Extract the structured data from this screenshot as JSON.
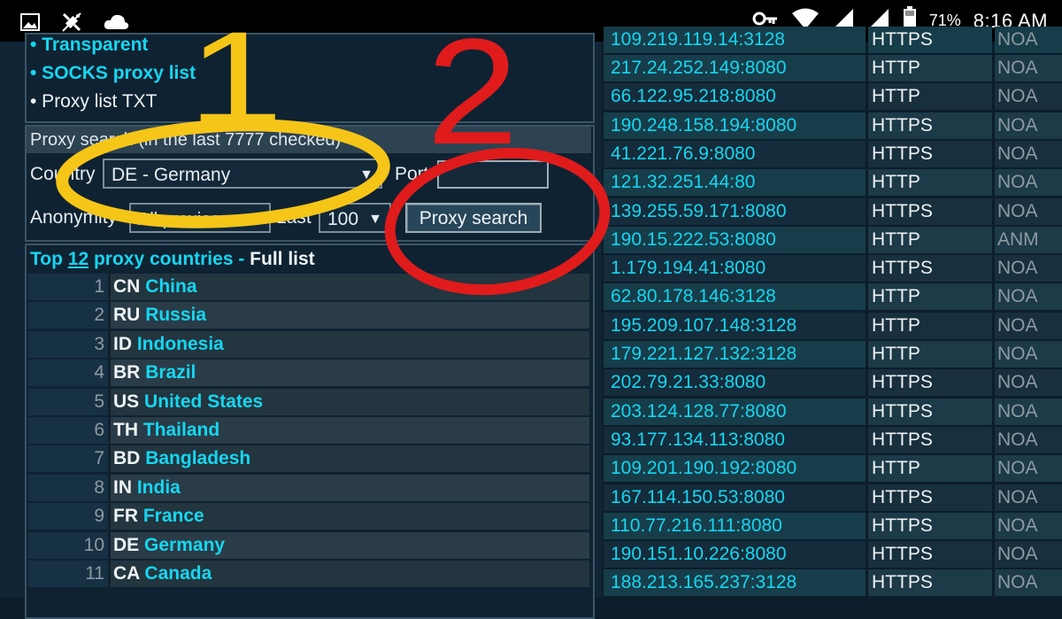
{
  "status_bar": {
    "battery_percent": "71%",
    "time": "8:16 AM",
    "icons": [
      "image-icon",
      "satellite-icon",
      "cloud-icon",
      "key-icon",
      "wifi-icon",
      "signal-icon",
      "signal-icon",
      "battery-icon"
    ]
  },
  "menu": {
    "transparent": "• Transparent",
    "socks": "• SOCKS proxy list",
    "txt": "• Proxy list TXT"
  },
  "search": {
    "title": "Proxy search (in the last 7777 checked)",
    "country_label": "Country",
    "country_value": "DE - Germany",
    "port_label": "Port",
    "anonymity_label": "Anonymity",
    "anonymity_value": "All proxies",
    "last_label": "Last",
    "last_value": "100",
    "button": "Proxy search"
  },
  "countries": {
    "title_prefix": "Top ",
    "title_count": "12",
    "title_suffix": " proxy countries - ",
    "title_full": "Full list",
    "rows": [
      {
        "num": "1",
        "code": "CN",
        "name": "China"
      },
      {
        "num": "2",
        "code": "RU",
        "name": "Russia"
      },
      {
        "num": "3",
        "code": "ID",
        "name": "Indonesia"
      },
      {
        "num": "4",
        "code": "BR",
        "name": "Brazil"
      },
      {
        "num": "5",
        "code": "US",
        "name": "United States"
      },
      {
        "num": "6",
        "code": "TH",
        "name": "Thailand"
      },
      {
        "num": "7",
        "code": "BD",
        "name": "Bangladesh"
      },
      {
        "num": "8",
        "code": "IN",
        "name": "India"
      },
      {
        "num": "9",
        "code": "FR",
        "name": "France"
      },
      {
        "num": "10",
        "code": "DE",
        "name": "Germany"
      },
      {
        "num": "11",
        "code": "CA",
        "name": "Canada"
      }
    ]
  },
  "proxies": {
    "partial_top": {
      "ip": "109.219.119.14:3128",
      "proto": "HTTPS",
      "anon": "NOA"
    },
    "rows": [
      {
        "ip": "217.24.252.149:8080",
        "proto": "HTTP",
        "anon": "NOA"
      },
      {
        "ip": "66.122.95.218:8080",
        "proto": "HTTP",
        "anon": "NOA"
      },
      {
        "ip": "190.248.158.194:8080",
        "proto": "HTTPS",
        "anon": "NOA"
      },
      {
        "ip": "41.221.76.9:8080",
        "proto": "HTTPS",
        "anon": "NOA"
      },
      {
        "ip": "121.32.251.44:80",
        "proto": "HTTP",
        "anon": "NOA"
      },
      {
        "ip": "139.255.59.171:8080",
        "proto": "HTTPS",
        "anon": "NOA"
      },
      {
        "ip": "190.15.222.53:8080",
        "proto": "HTTP",
        "anon": "ANM"
      },
      {
        "ip": "1.179.194.41:8080",
        "proto": "HTTPS",
        "anon": "NOA"
      },
      {
        "ip": "62.80.178.146:3128",
        "proto": "HTTP",
        "anon": "NOA"
      },
      {
        "ip": "195.209.107.148:3128",
        "proto": "HTTP",
        "anon": "NOA"
      },
      {
        "ip": "179.221.127.132:3128",
        "proto": "HTTP",
        "anon": "NOA"
      },
      {
        "ip": "202.79.21.33:8080",
        "proto": "HTTPS",
        "anon": "NOA"
      },
      {
        "ip": "203.124.128.77:8080",
        "proto": "HTTPS",
        "anon": "NOA"
      },
      {
        "ip": "93.177.134.113:8080",
        "proto": "HTTPS",
        "anon": "NOA"
      },
      {
        "ip": "109.201.190.192:8080",
        "proto": "HTTP",
        "anon": "NOA"
      },
      {
        "ip": "167.114.150.53:8080",
        "proto": "HTTPS",
        "anon": "NOA"
      },
      {
        "ip": "110.77.216.111:8080",
        "proto": "HTTPS",
        "anon": "NOA"
      },
      {
        "ip": "190.151.10.226:8080",
        "proto": "HTTPS",
        "anon": "NOA"
      },
      {
        "ip": "188.213.165.237:3128",
        "proto": "HTTPS",
        "anon": "NOA"
      }
    ]
  },
  "annotations": {
    "step1": "1",
    "step2": "2",
    "step1_color": "#f5c518",
    "step2_color": "#e01b1b"
  }
}
